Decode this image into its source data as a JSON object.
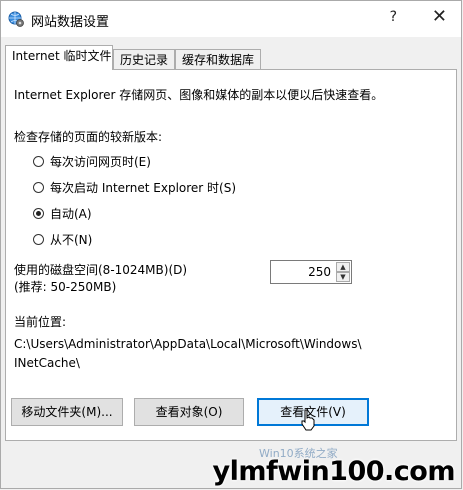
{
  "window": {
    "title": "网站数据设置",
    "help_glyph": "?",
    "close_glyph": "✕",
    "icon": "settings-globe-icon"
  },
  "tabs": [
    {
      "label": "Internet 临时文件",
      "active": true
    },
    {
      "label": "历史记录",
      "active": false
    },
    {
      "label": "缓存和数据库",
      "active": false
    }
  ],
  "panel": {
    "description": "Internet Explorer 存储网页、图像和媒体的副本以便以后快速查看。",
    "check_label": "检查存储的页面的较新版本:",
    "radios": [
      {
        "label": "每次访问网页时(E)",
        "checked": false
      },
      {
        "label": "每次启动 Internet Explorer 时(S)",
        "checked": false
      },
      {
        "label": "自动(A)",
        "checked": true
      },
      {
        "label": "从不(N)",
        "checked": false
      }
    ],
    "disk_label_line1": "使用的磁盘空间(8-1024MB)(D)",
    "disk_label_line2": "(推荐: 50-250MB)",
    "disk_value": "250",
    "location_label": "当前位置:",
    "location_line1": "C:\\Users\\Administrator\\AppData\\Local\\Microsoft\\Windows\\",
    "location_line2": "INetCache\\"
  },
  "buttons": {
    "move_folder": "移动文件夹(M)...",
    "view_objects": "查看对象(O)",
    "view_files": "查看文件(V)"
  },
  "watermark": {
    "text": "ylmfwin100.com",
    "sub": "Win10系统之家"
  },
  "colors": {
    "focus": "#0078d7",
    "panel_bg": "#ffffff",
    "dialog_bg": "#f0f0f0"
  }
}
